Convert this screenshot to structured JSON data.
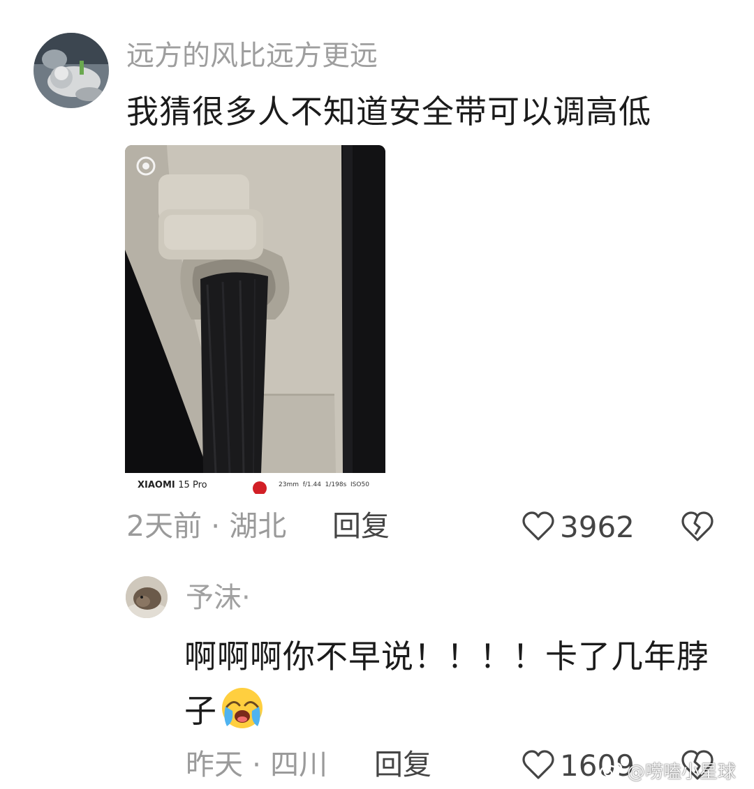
{
  "main_comment": {
    "username": "远方的风比远方更远",
    "text": "我猜很多人不知道安全带可以调高低",
    "photo": {
      "camera_brand": "XIAOMI",
      "camera_model": "15 Pro",
      "exif": "23mm  f/1.44  1/198s  ISO50"
    },
    "time": "2天前",
    "location": "湖北",
    "separator": "·",
    "reply_label": "回复",
    "likes": "3962",
    "like_icon": "heart-outline-icon",
    "dislike_icon": "broken-heart-icon"
  },
  "reply_comment": {
    "username": "予沫·",
    "text": "啊啊啊你不早说！！！！卡了几年脖子",
    "emoji": "crying-laughing-face",
    "time": "昨天",
    "location": "四川",
    "separator": "·",
    "reply_label": "回复",
    "likes": "1609"
  },
  "watermark": "@唠嗑小星球",
  "colors": {
    "username": "#9e9e9e",
    "text": "#1b1b1b",
    "meta": "#9a9a9a",
    "action": "#444444",
    "background": "#ffffff"
  }
}
